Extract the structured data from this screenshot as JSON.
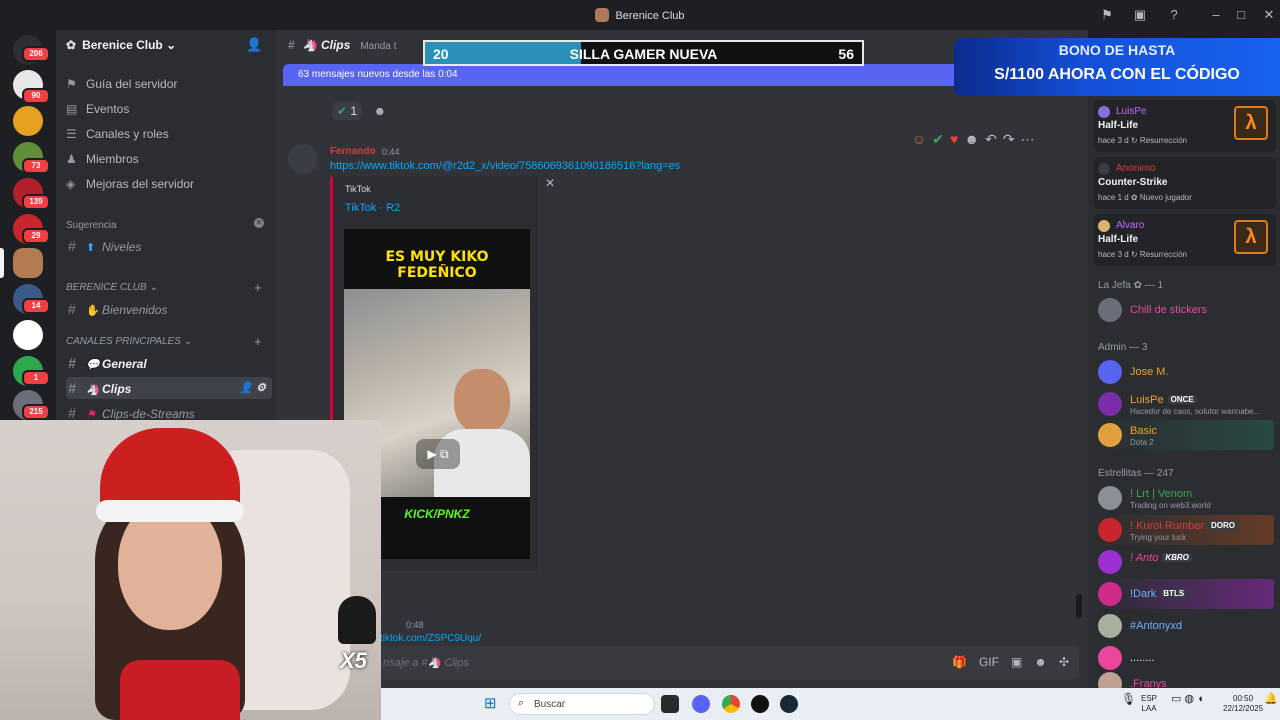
{
  "window": {
    "title": "Berenice Club"
  },
  "rail": {
    "badges": [
      "206",
      "90",
      "73",
      "139",
      "29",
      "14",
      "1",
      "215"
    ]
  },
  "sidebar": {
    "server_name": "Berenice Club",
    "nav": [
      {
        "label": "Guía del servidor",
        "icon": "signpost-icon"
      },
      {
        "label": "Eventos",
        "icon": "calendar-icon"
      },
      {
        "label": "Canales y roles",
        "icon": "list-icon"
      },
      {
        "label": "Miembros",
        "icon": "members-icon"
      },
      {
        "label": "Mejoras del servidor",
        "icon": "boost-icon"
      }
    ],
    "suggestion_label": "Sugerencia",
    "suggestion_channel": "Niveles",
    "cat1": "BERENICE CLUB",
    "cat1_channel": "Bienvenidos",
    "cat2": "CANALES PRINCIPALES",
    "channels": [
      "General",
      "Clips",
      "Clips-de-Streams"
    ]
  },
  "chat": {
    "channel": "Clips",
    "topic": "Manda t",
    "new_messages": "63 mensajes nuevos desde las 0:04",
    "reaction_count": "1",
    "author": "Fernando",
    "time": "0:44",
    "link": "https://www.tiktok.com/@r2d2_x/video/7586069361090186516?lang=es",
    "embed_provider": "TikTok",
    "embed_title": "TikTok · R2",
    "video_caption_1": "ES MUY KIKO",
    "video_caption_2": "FEDEÑICO",
    "video_brand": "KICK/PNKZ",
    "msg2_time": "0:48",
    "msg2_link": "tiktok.com/ZSPC9Uqu/",
    "composer_placeholder": "nsaje a #",
    "composer_channel": "Clips"
  },
  "overlay": {
    "goal_left": "20",
    "goal_title": "SILLA GAMER NUEVA",
    "goal_right": "56",
    "goal_progress": 0.357,
    "promo_line1": "BONO DE HASTA",
    "promo_line2": "S/1100 AHORA CON EL CÓDIGO"
  },
  "members": {
    "activities": [
      {
        "name": "LuisPe",
        "game": "Half-Life",
        "meta": "hace 3 d  ↻ Resurrección",
        "img": "λ"
      },
      {
        "name": "Anonimo",
        "game": "Counter-Strike",
        "meta": "hace 1 d  ✿ Nuevo jugador",
        "img": ""
      },
      {
        "name": "Alvaro",
        "game": "Half-Life",
        "meta": "hace 3 d  ↻ Resurrección",
        "img": "λ"
      }
    ],
    "group1": "La Jefa ✿ — 1",
    "jefa": {
      "name": "Chill de stickers"
    },
    "group2": "Admin — 3",
    "admins": [
      {
        "name": "Jose M.",
        "sub": "",
        "tag": ""
      },
      {
        "name": "LuisPe",
        "sub": "Hacedor de caos, solutor wannabe...",
        "tag": "ONCE"
      },
      {
        "name": "Basic",
        "sub": "Dota 2",
        "tag": ""
      }
    ],
    "group3": "Estrellitas — 247",
    "stars": [
      {
        "name": "! Lrt | Venom",
        "sub": "Trading on web3.world",
        "tag": ""
      },
      {
        "name": "! Kuroi Rumber",
        "sub": "Trying your luck",
        "tag": "DORO"
      },
      {
        "name": "! Anto",
        "sub": "",
        "tag": "KBRO"
      },
      {
        "name": "!Dark",
        "sub": "",
        "tag": "BTLS"
      },
      {
        "name": "#Antonyxd",
        "sub": "",
        "tag": ""
      },
      {
        "name": "........",
        "sub": "",
        "tag": ""
      },
      {
        "name": ".Franys",
        "sub": "",
        "tag": ""
      }
    ]
  },
  "cam": {
    "multiplier": "X5"
  },
  "taskbar": {
    "search_placeholder": "Buscar",
    "lang": "ESP",
    "lang2": "LAA",
    "time": "00:50",
    "date": "22/12/2025"
  },
  "colors": {
    "accent": "#5865f2",
    "link": "#00a8fc",
    "danger": "#f23f43"
  }
}
